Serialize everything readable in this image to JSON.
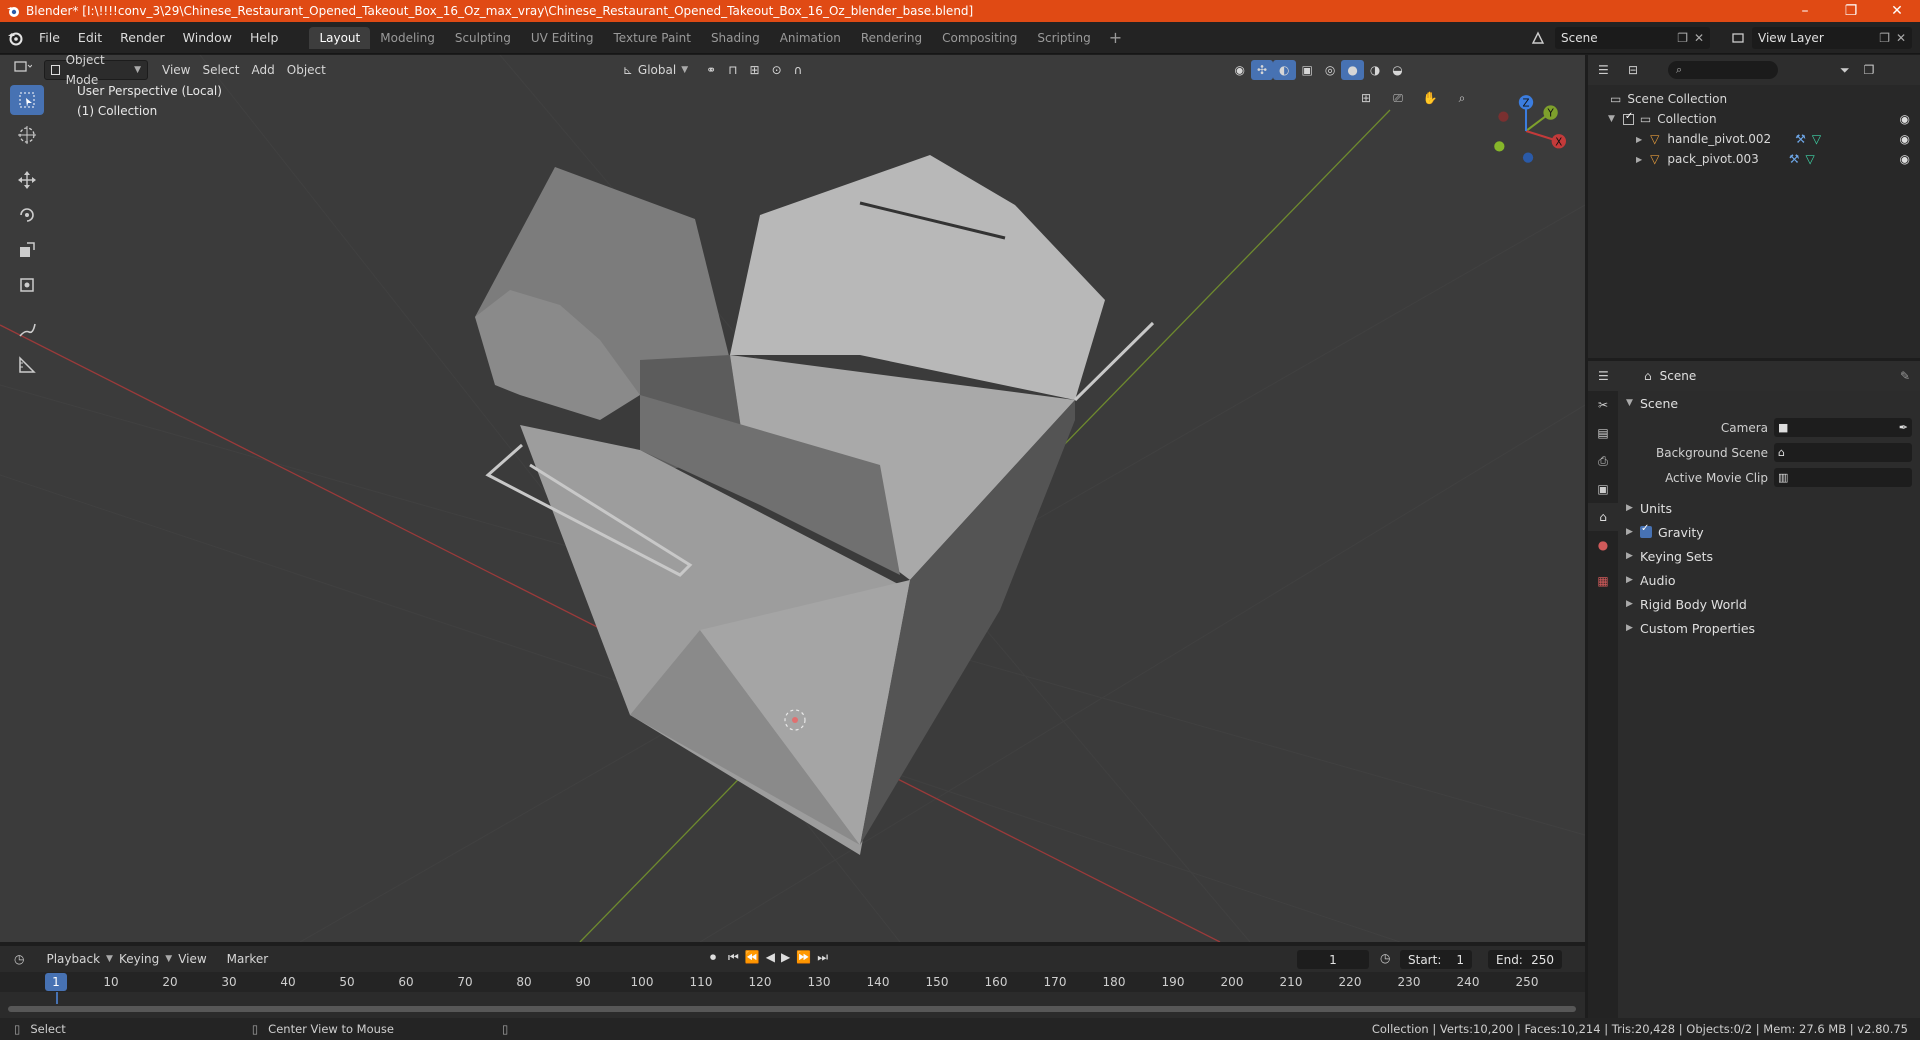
{
  "window": {
    "title": "Blender* [I:\\!!!!conv_3\\29\\Chinese_Restaurant_Opened_Takeout_Box_16_Oz_max_vray\\Chinese_Restaurant_Opened_Takeout_Box_16_Oz_blender_base.blend]",
    "minimize": "–",
    "restore": "❐",
    "close": "✕"
  },
  "menu": {
    "items": [
      "File",
      "Edit",
      "Render",
      "Window",
      "Help"
    ],
    "workspaces": [
      "Layout",
      "Modeling",
      "Sculpting",
      "UV Editing",
      "Texture Paint",
      "Shading",
      "Animation",
      "Rendering",
      "Compositing",
      "Scripting"
    ],
    "active_workspace": "Layout",
    "add_workspace": "+",
    "scene": "Scene",
    "view_layer": "View Layer"
  },
  "viewport": {
    "mode": "Object Mode",
    "menus": [
      "View",
      "Select",
      "Add",
      "Object"
    ],
    "orientation": "Global",
    "perspective_label": "User Perspective (Local)",
    "collection_label": "(1) Collection"
  },
  "gizmo": {
    "x": "X",
    "y": "Y",
    "z": "Z"
  },
  "outliner": {
    "root": "Scene Collection",
    "collection": "Collection",
    "objects": [
      "handle_pivot.002",
      "pack_pivot.003"
    ]
  },
  "properties": {
    "header": "Scene",
    "section": "Scene",
    "rows": [
      {
        "label": "Camera"
      },
      {
        "label": "Background Scene"
      },
      {
        "label": "Active Movie Clip"
      }
    ],
    "panels": [
      "Units",
      "Gravity",
      "Keying Sets",
      "Audio",
      "Rigid Body World",
      "Custom Properties"
    ]
  },
  "timeline": {
    "menus": [
      "Playback",
      "Keying",
      "View",
      "Marker"
    ],
    "current_frame": "1",
    "start_label": "Start:",
    "start": "1",
    "end_label": "End:",
    "end": "250",
    "ticks": [
      "1",
      "10",
      "20",
      "30",
      "40",
      "50",
      "60",
      "70",
      "80",
      "90",
      "100",
      "110",
      "120",
      "130",
      "140",
      "150",
      "160",
      "170",
      "180",
      "190",
      "200",
      "210",
      "220",
      "230",
      "240",
      "250"
    ]
  },
  "status": {
    "select": "Select",
    "center_view": "Center View to Mouse",
    "stats": "Collection | Verts:10,200 | Faces:10,214 | Tris:20,428 | Objects:0/2 | Mem: 27.6 MB | v2.80.75"
  },
  "colors": {
    "title_bar": "#e04a14",
    "accent": "#4772b3",
    "x_axis": "#c33a3a",
    "y_axis": "#7ea02c",
    "z_axis": "#3b7de0"
  }
}
